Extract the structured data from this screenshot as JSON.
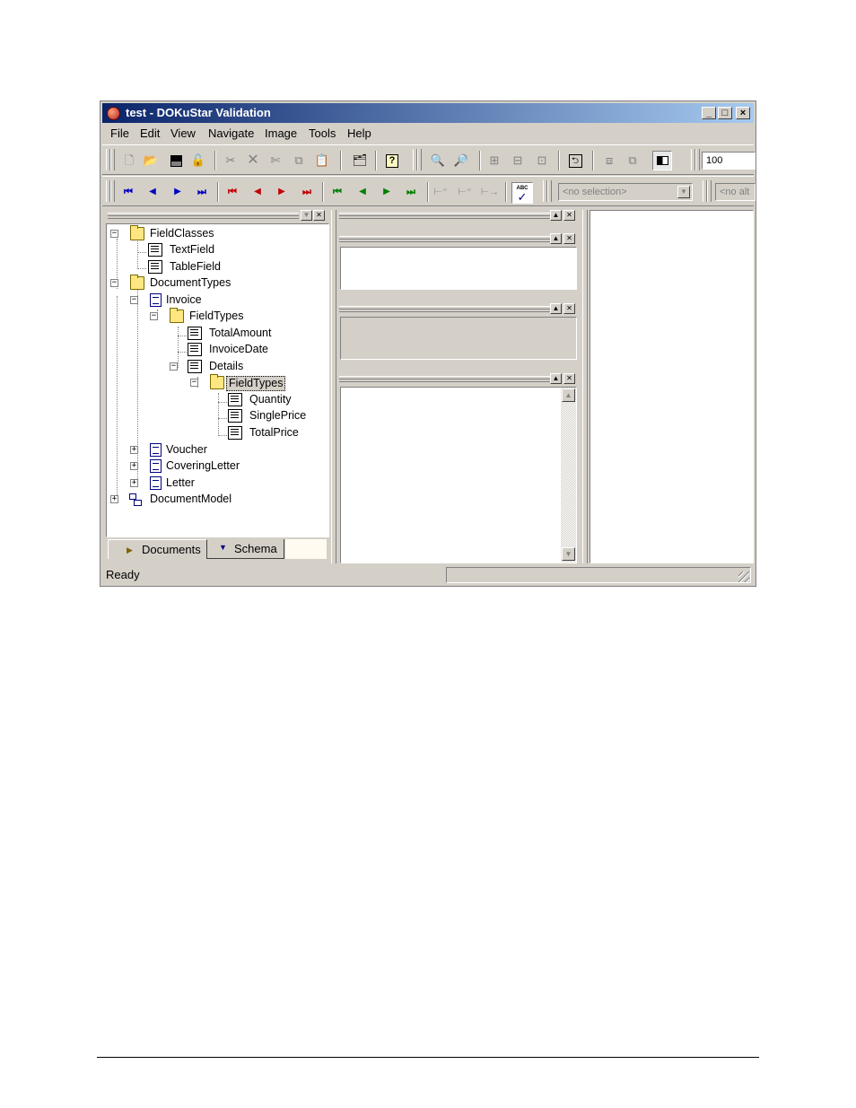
{
  "window": {
    "title": "test - DOKuStar Validation",
    "controls": {
      "minimize": "_",
      "maximize": "□",
      "close": "×"
    }
  },
  "menu": [
    "File",
    "Edit",
    "View",
    "Navigate",
    "Image",
    "Tools",
    "Help"
  ],
  "toolbar1": {
    "zoom_value": "100",
    "icons": [
      "new-icon",
      "open-icon",
      "save-icon",
      "unlock-icon",
      "cut-icon",
      "delete-icon",
      "cut-field-icon",
      "copy-icon",
      "paste-icon",
      "import-icon",
      "help-icon",
      "zoom-in-icon",
      "zoom-out-icon",
      "fit-page-icon",
      "fit-width-icon",
      "fit-height-icon",
      "rotate-icon",
      "arrange-icon",
      "compare-icon",
      "contrast-icon"
    ]
  },
  "toolbar2": {
    "selection_placeholder": "<no selection>",
    "alt_placeholder": "<no alt",
    "colors": {
      "blue": "#0000c0",
      "red": "#c00000",
      "green": "#008000"
    }
  },
  "tree": {
    "nodes": [
      {
        "label": "FieldClasses",
        "icon": "folder-icon"
      },
      {
        "label": "TextField",
        "icon": "field-icon"
      },
      {
        "label": "TableField",
        "icon": "field-icon"
      },
      {
        "label": "DocumentTypes",
        "icon": "folder-icon"
      },
      {
        "label": "Invoice",
        "icon": "document-icon"
      },
      {
        "label": "FieldTypes",
        "icon": "folder-icon"
      },
      {
        "label": "TotalAmount",
        "icon": "field-icon"
      },
      {
        "label": "InvoiceDate",
        "icon": "field-icon"
      },
      {
        "label": "Details",
        "icon": "field-icon"
      },
      {
        "label": "FieldTypes",
        "icon": "folder-icon"
      },
      {
        "label": "Quantity",
        "icon": "field-icon"
      },
      {
        "label": "SinglePrice",
        "icon": "field-icon"
      },
      {
        "label": "TotalPrice",
        "icon": "field-icon"
      },
      {
        "label": "Voucher",
        "icon": "document-icon"
      },
      {
        "label": "CoveringLetter",
        "icon": "document-icon"
      },
      {
        "label": "Letter",
        "icon": "document-icon"
      },
      {
        "label": "DocumentModel",
        "icon": "model-icon"
      }
    ],
    "selected": "FieldTypes"
  },
  "tabs": {
    "documents": "Documents",
    "schema": "Schema"
  },
  "status": {
    "text": "Ready"
  }
}
